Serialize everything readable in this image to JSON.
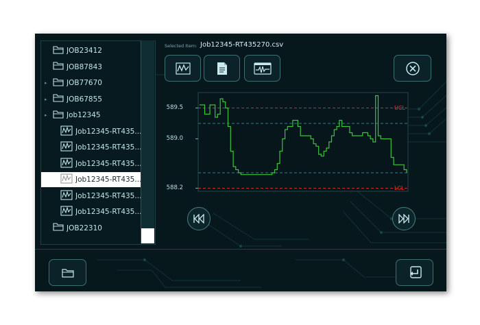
{
  "tree": {
    "items": [
      {
        "label": "JOB23412",
        "type": "folder",
        "expander": false
      },
      {
        "label": "JOB87843",
        "type": "folder",
        "expander": false
      },
      {
        "label": "JOB77670",
        "type": "folder",
        "expander": true
      },
      {
        "label": "JOB67855",
        "type": "folder",
        "expander": true
      },
      {
        "label": "Job12345",
        "type": "folder",
        "expander": true
      },
      {
        "label": "Job12345-RT435...",
        "type": "file",
        "expander": false
      },
      {
        "label": "Job12345-RT435...",
        "type": "file",
        "expander": false
      },
      {
        "label": "Job12345-RT435...",
        "type": "file",
        "expander": false
      },
      {
        "label": "Job12345-RT435...",
        "type": "file",
        "expander": false,
        "selected": true
      },
      {
        "label": "Job12345-RT435...",
        "type": "file",
        "expander": false
      },
      {
        "label": "Job12345-RT435...",
        "type": "file",
        "expander": false
      },
      {
        "label": "JOB22310",
        "type": "folder",
        "expander": false
      }
    ]
  },
  "header": {
    "selected_label": "Selected Item:",
    "selected_value": "Job12345-RT435270.csv"
  },
  "toolbar": {
    "icons": [
      "chart-view-icon",
      "document-icon",
      "waveform-icon"
    ],
    "close_icon": "close-circle-icon"
  },
  "chart_data": {
    "type": "line",
    "ylim": [
      588.15,
      589.75
    ],
    "y_ticks": [
      589.5,
      589.0,
      588.2
    ],
    "y_tick_labels": [
      "589.5",
      "589.0",
      "588.2"
    ],
    "ucl": 589.5,
    "lcl": 588.2,
    "ucl_label": "UCL",
    "lcl_label": "LCL",
    "inner_limits": [
      589.25,
      588.45
    ],
    "series": [
      {
        "color": "#3ec43e",
        "values": [
          589.55,
          589.55,
          589.4,
          589.4,
          589.55,
          589.55,
          589.35,
          589.4,
          589.65,
          589.6,
          589.5,
          589.2,
          588.8,
          588.55,
          588.5,
          588.45,
          588.42,
          588.42,
          588.42,
          588.42,
          588.42,
          588.42,
          588.42,
          588.42,
          588.42,
          588.42,
          588.42,
          588.42,
          588.45,
          588.5,
          588.6,
          588.8,
          589.0,
          589.15,
          589.2,
          589.2,
          589.3,
          589.3,
          589.2,
          589.05,
          589.05,
          589.05,
          589.05,
          589.0,
          588.92,
          588.88,
          588.75,
          588.72,
          588.8,
          588.85,
          588.95,
          589.05,
          589.15,
          589.2,
          589.3,
          589.2,
          589.2,
          589.2,
          589.1,
          589.05,
          589.05,
          589.05,
          589.05,
          589.1,
          589.1,
          589.05,
          589.0,
          588.95,
          589.7,
          589.05,
          589.0,
          589.0,
          589.0,
          589.0,
          588.7,
          588.58,
          588.58,
          588.58,
          588.58,
          588.5,
          588.45
        ]
      }
    ]
  },
  "navigation": {
    "prev_icon": "rewind-icon",
    "next_icon": "fast-forward-icon"
  },
  "footer": {
    "left_icon": "folder-icon",
    "right_icon": "return-icon"
  }
}
